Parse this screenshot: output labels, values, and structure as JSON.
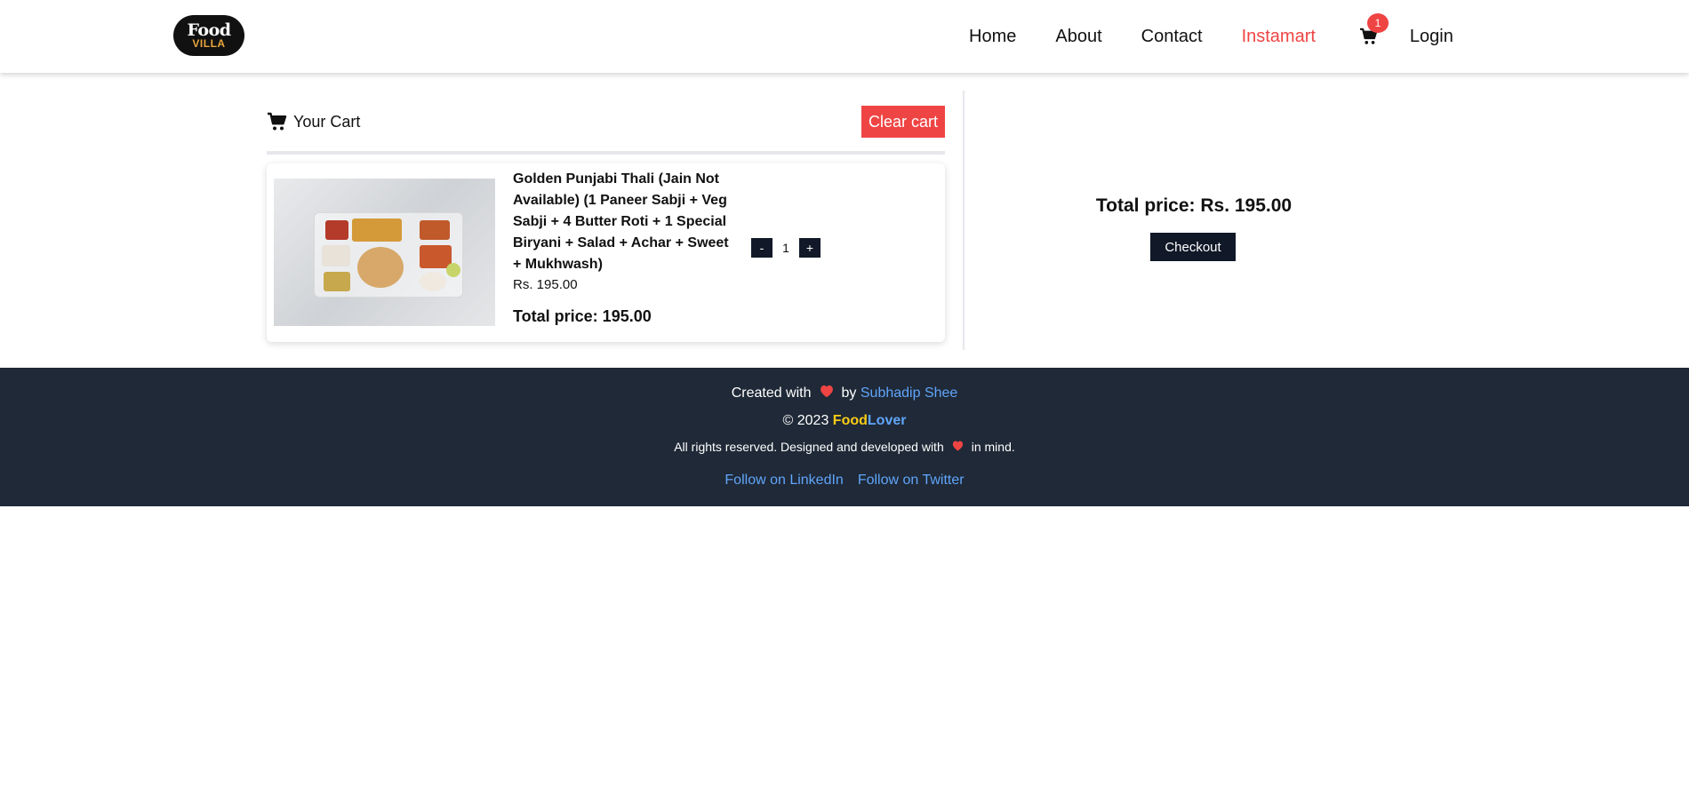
{
  "header": {
    "logo": {
      "line1": "Food",
      "line2": "VILLA"
    },
    "nav": [
      {
        "label": "Home"
      },
      {
        "label": "About"
      },
      {
        "label": "Contact"
      },
      {
        "label": "Instamart"
      }
    ],
    "cart_badge": "1",
    "login_label": "Login",
    "accent_color": "#ef4444"
  },
  "cart": {
    "title": "Your Cart",
    "clear_label": "Clear cart",
    "icon": "shopping-cart-icon",
    "items": [
      {
        "name": "Golden Punjabi Thali (Jain Not Available) (1 Paneer Sabji + Veg Sabji + 4 Butter Roti + 1 Special Biryani + Salad + Achar + Sweet + Mukhwash)",
        "price": "Rs. 195.00",
        "total": "Total price: 195.00",
        "qty": "1",
        "minus": "-",
        "plus": "+"
      }
    ]
  },
  "summary": {
    "total": "Total price: Rs. 195.00",
    "checkout_label": "Checkout"
  },
  "footer": {
    "created_with": "Created with",
    "by": "by",
    "author": "Subhadip Shee",
    "copyright": "© 2023",
    "brand_a": "Food",
    "brand_b": "Lover",
    "rights_prefix": "All rights reserved. Designed and developed with",
    "rights_suffix": "in mind.",
    "linkedin": "Follow on LinkedIn",
    "twitter": "Follow on Twitter",
    "background_color": "#1f2937",
    "link_color": "#60a5fa"
  }
}
